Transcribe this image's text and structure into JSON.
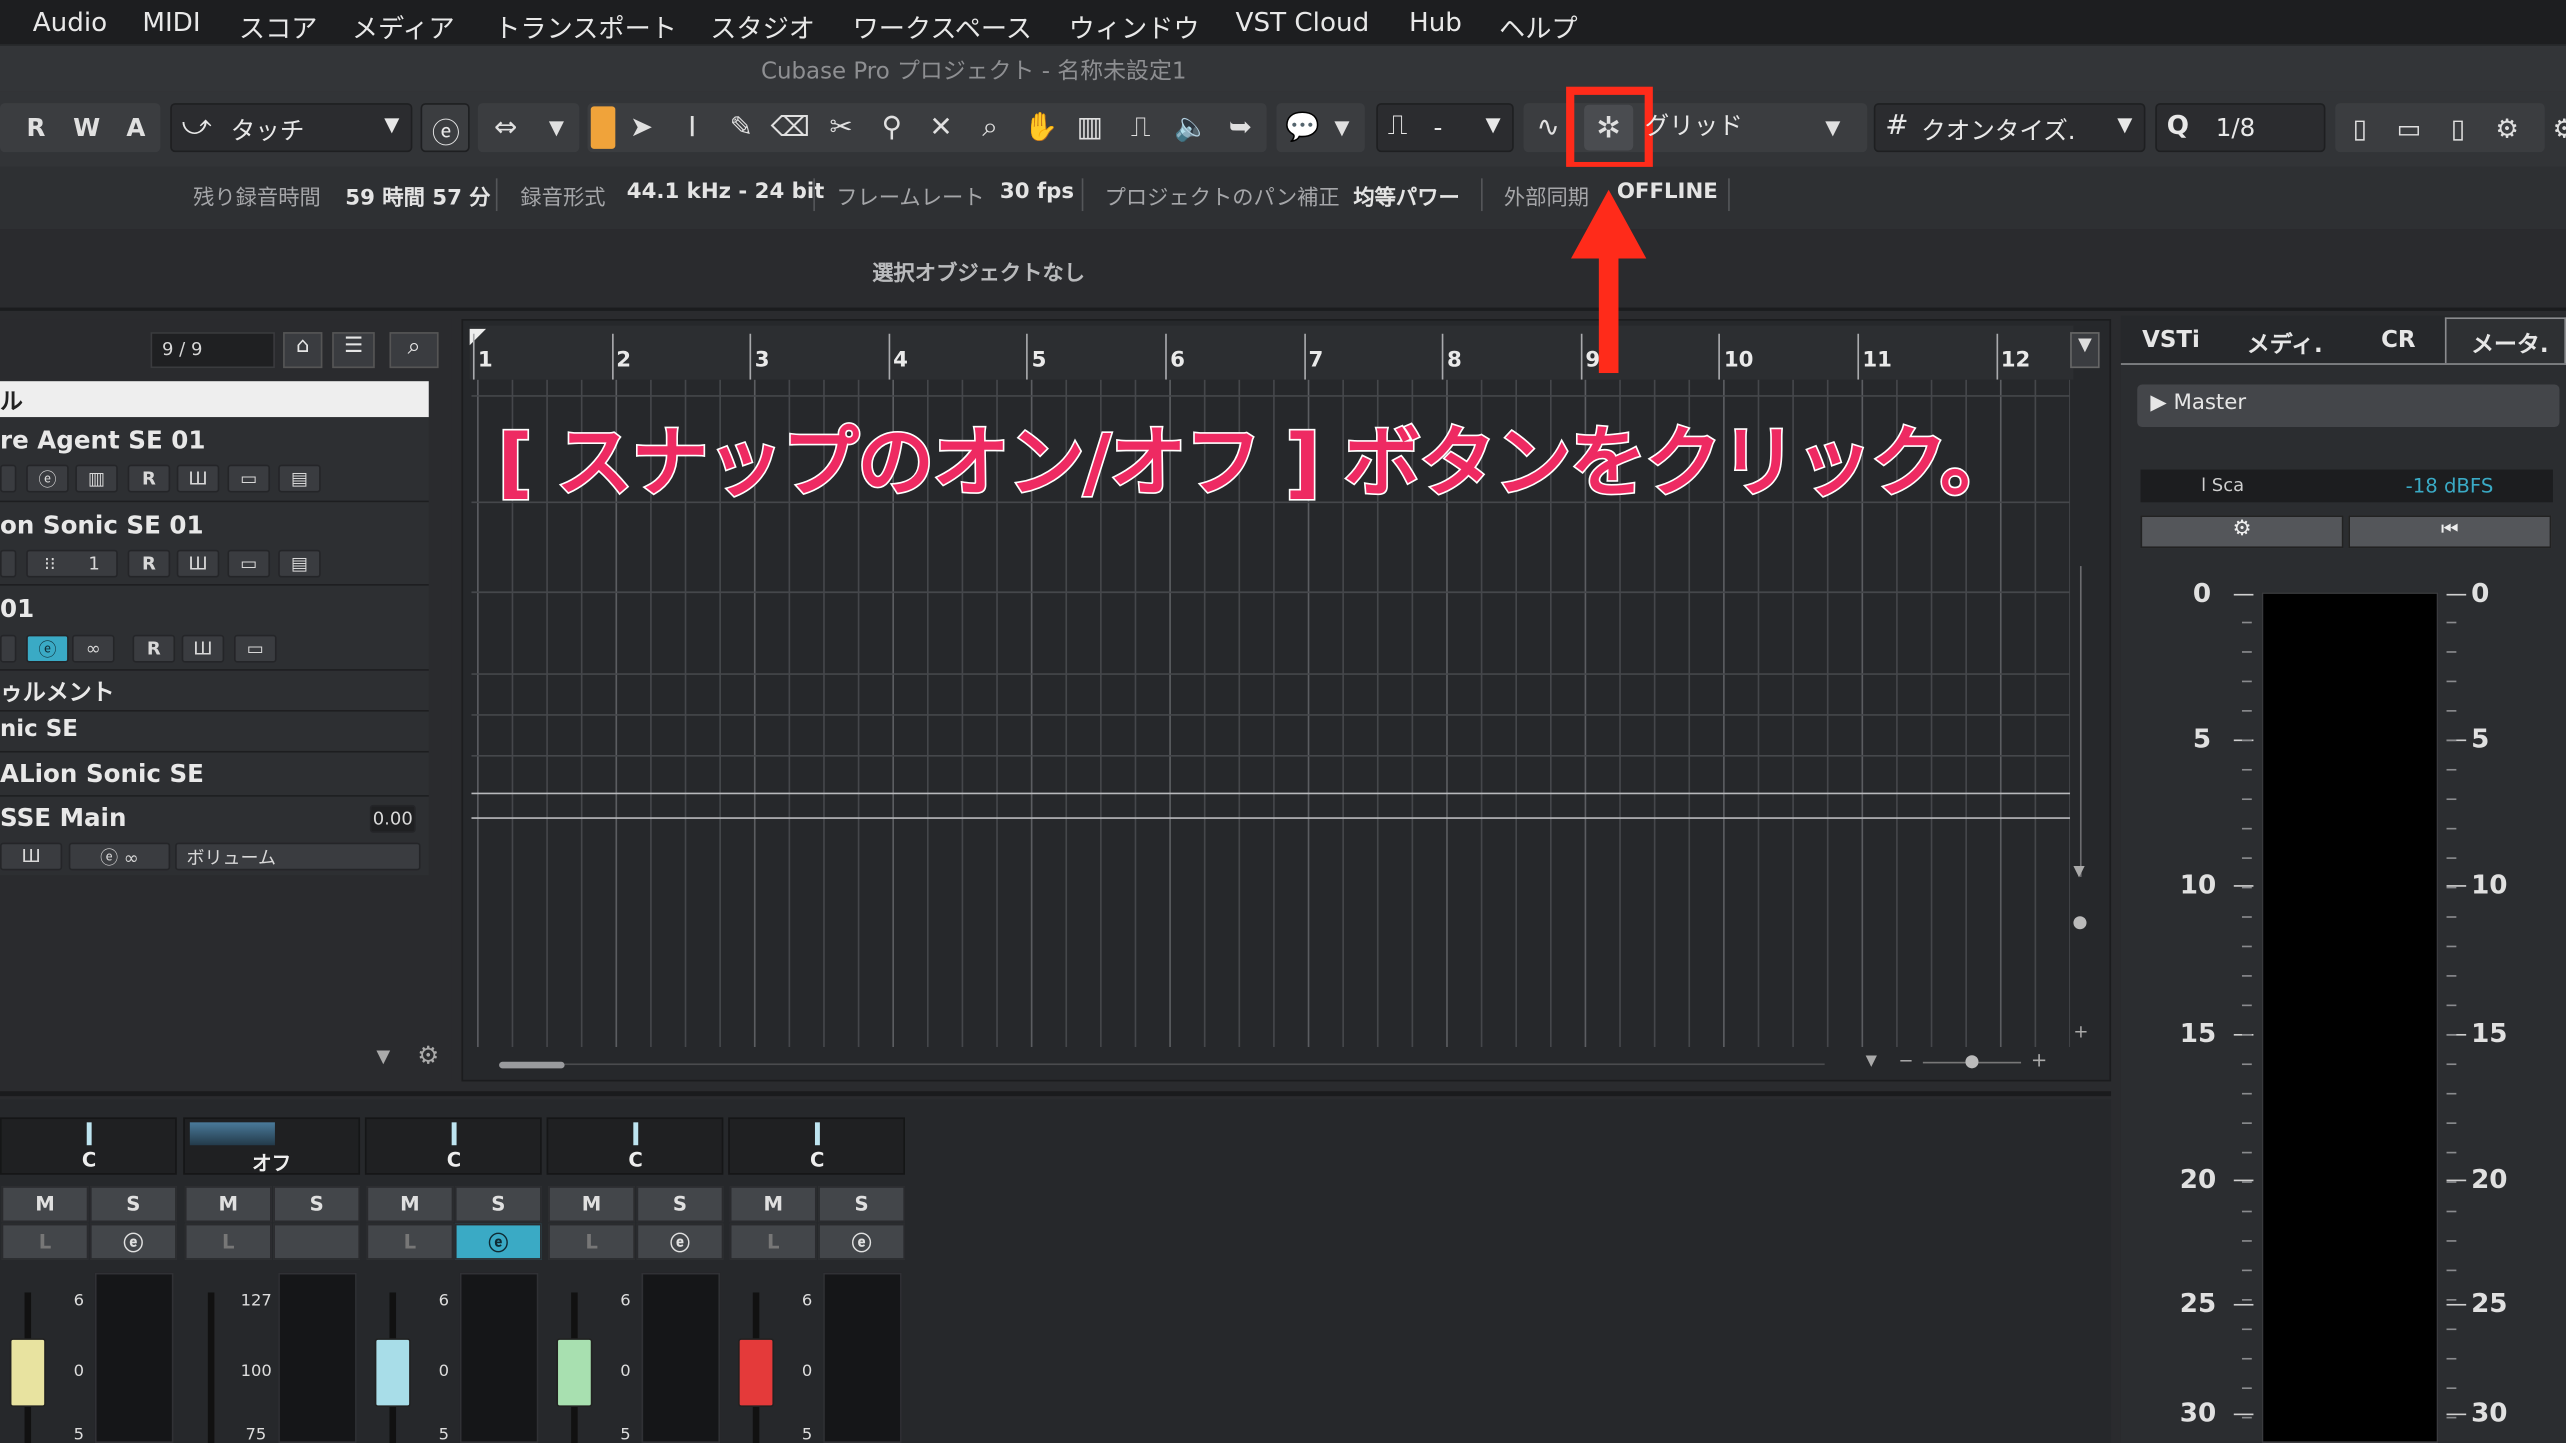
{
  "menu": [
    "Audio",
    "MIDI",
    "スコア",
    "メディア",
    "トランスポート",
    "スタジオ",
    "ワークスペース",
    "ウィンドウ",
    "VST Cloud",
    "Hub",
    "ヘルプ"
  ],
  "window_title": "Cubase Pro プロジェクト - 名称未設定1",
  "toolbar": {
    "rwa": [
      "R",
      "W",
      "A"
    ],
    "automation_mode": "タッチ",
    "snap_type": "グリッド",
    "quantize_label": "クオンタイズ.",
    "quantize_value": "1/8",
    "pulse_dash": "-"
  },
  "info": {
    "rec_time_label": "残り録音時間",
    "rec_time_value": "59 時間 57 分",
    "rec_format_label": "録音形式",
    "rec_format_value": "44.1 kHz - 24 bit",
    "framerate_label": "フレームレート",
    "framerate_value": "30 fps",
    "pan_label": "プロジェクトのパン補正",
    "pan_value": "均等パワー",
    "sync_label": "外部同期",
    "sync_value": "OFFLINE"
  },
  "selection_text": "選択オブジェクトなし",
  "track_list": {
    "count": "9 / 9",
    "header": "ル",
    "tracks": [
      {
        "name": "re Agent SE 01"
      },
      {
        "name": "on Sonic SE 01",
        "num": "1"
      },
      {
        "name": " 01"
      },
      {
        "name": "ゥルメント"
      },
      {
        "name": "nic SE"
      },
      {
        "name": "ALion Sonic SE"
      },
      {
        "name": "SSE Main",
        "value": "0.00",
        "volume": "ボリューム"
      }
    ],
    "btn_r": "R"
  },
  "ruler_bars": [
    "1",
    "2",
    "3",
    "4",
    "5",
    "6",
    "7",
    "8",
    "9",
    "10",
    "11",
    "12"
  ],
  "right_tabs": [
    "VSTi",
    "メディ.",
    "CR",
    "メータ."
  ],
  "master_label": "▶ Master",
  "meter_scale": "-18 dBFS",
  "meter_partial_label": "l Sca",
  "meter_ticks": [
    "0",
    "5",
    "10",
    "15",
    "20",
    "25",
    "30"
  ],
  "mixer": {
    "pan": [
      "C",
      "オフ",
      "C",
      "C",
      "C"
    ],
    "mute": "M",
    "solo": "S",
    "listen": "L",
    "fader_scales": [
      [
        "6",
        "0",
        "5"
      ],
      [
        "127",
        "100",
        "75"
      ],
      [
        "6",
        "0",
        "5"
      ],
      [
        "6",
        "0",
        "5"
      ],
      [
        "6",
        "0",
        "5"
      ]
    ]
  },
  "callout": "[ スナップのオン/オフ ] ボタンをクリック。",
  "colors": {
    "highlight": "#ff2b1a",
    "callout": "#ee2a62",
    "accent_orange": "#f0a33a",
    "accent_teal": "#3aaac5"
  }
}
